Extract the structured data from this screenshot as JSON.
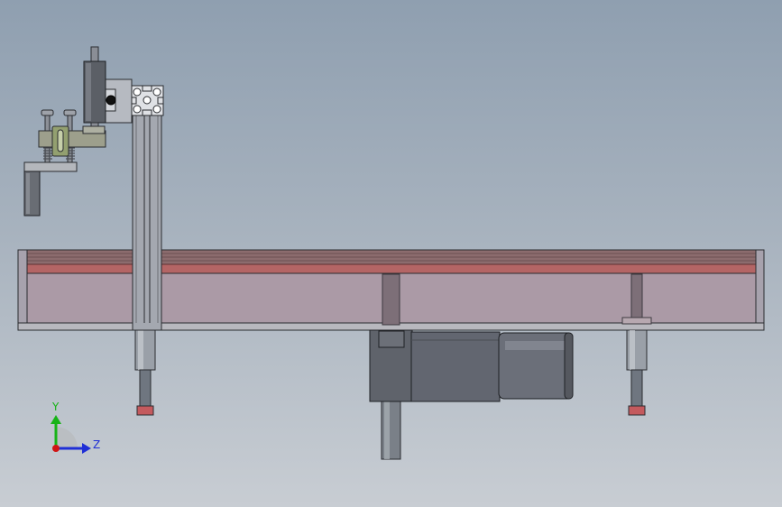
{
  "triad": {
    "y_label": "Y",
    "z_label": "Z",
    "y_color": "#17b317",
    "z_color": "#1f2fd6",
    "origin_color": "#d01414"
  },
  "colors": {
    "background_top": "#8f9fb0",
    "background_bottom": "#c8cdd3",
    "belt": "#b46565",
    "frame_fill": "#ab9aa6",
    "metal": "#8a8e96",
    "dark_metal": "#5f636b",
    "outline": "#2a2c30"
  }
}
